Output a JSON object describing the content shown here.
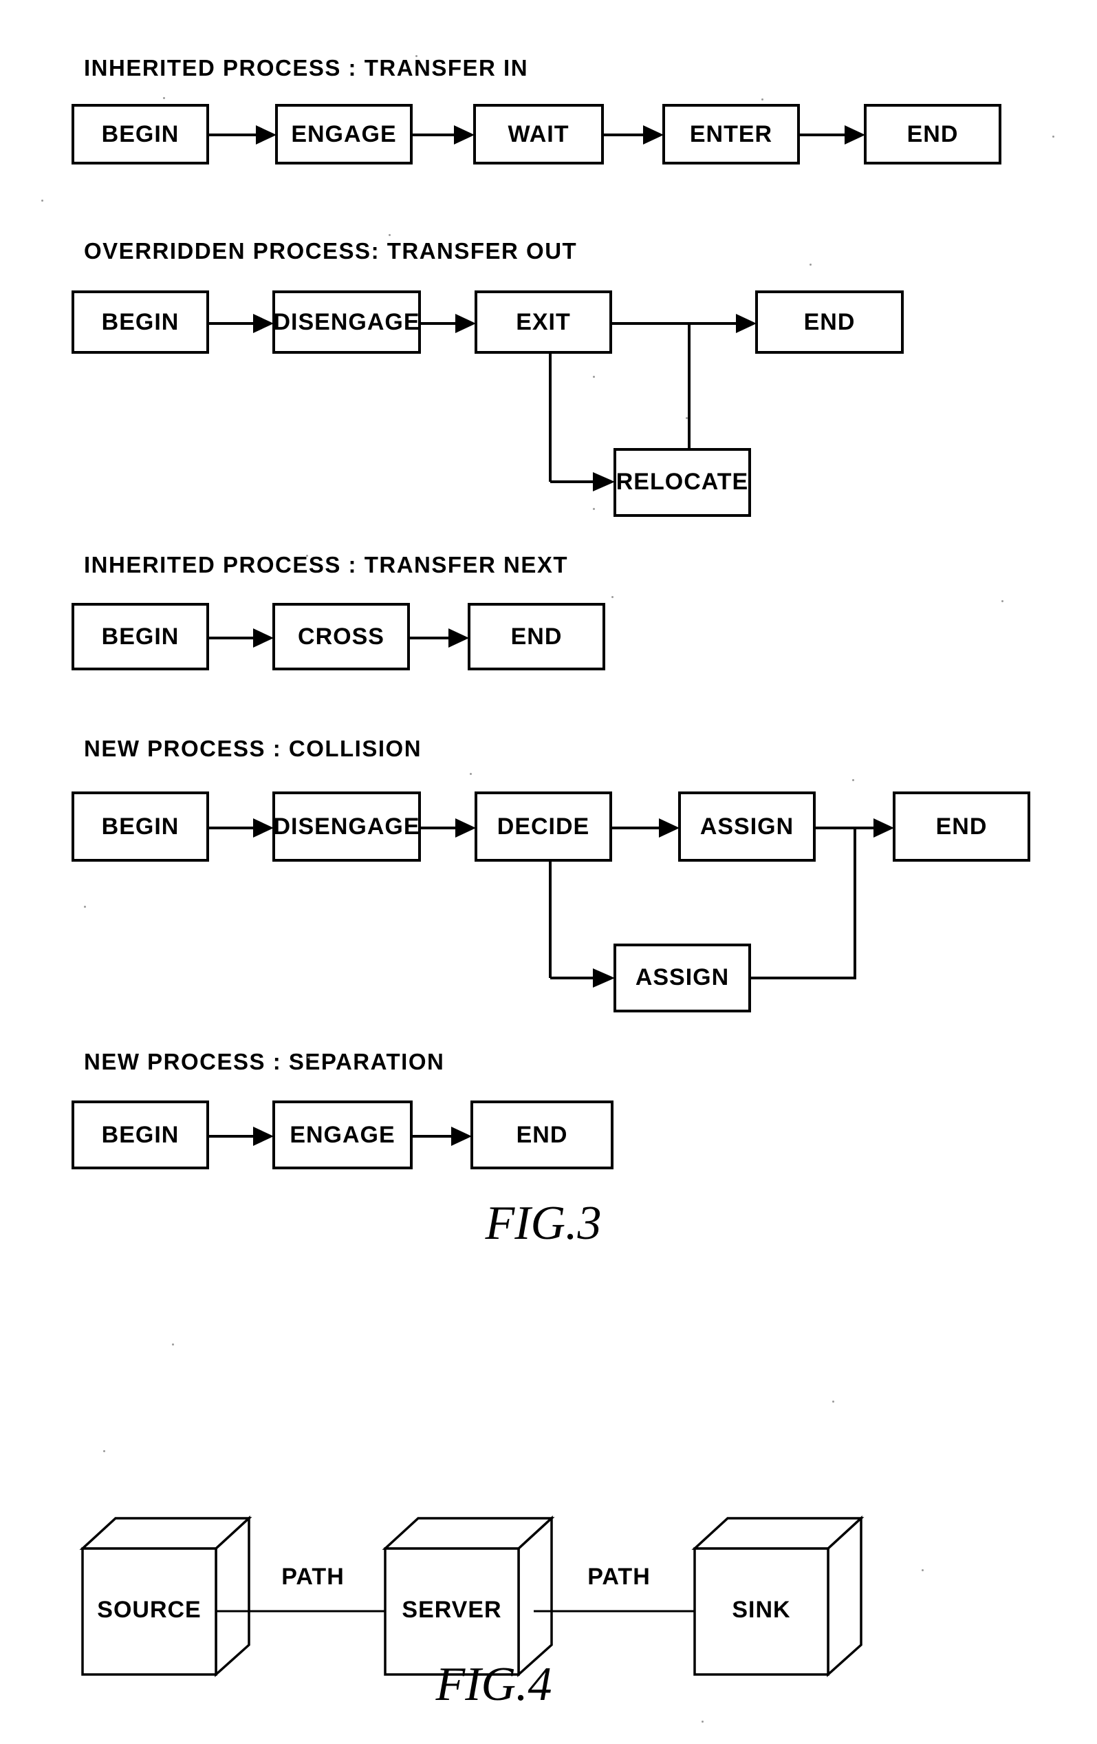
{
  "document": {
    "type": "patent-figure-sheet",
    "figures": [
      "FIG.3",
      "FIG.4"
    ]
  },
  "fig3": {
    "caption": "FIG.3",
    "processes": [
      {
        "heading": "INHERITED PROCESS : TRANSFER IN",
        "nodes": [
          "BEGIN",
          "ENGAGE",
          "WAIT",
          "ENTER",
          "END"
        ],
        "branch_nodes": []
      },
      {
        "heading": "OVERRIDDEN PROCESS: TRANSFER OUT",
        "nodes": [
          "BEGIN",
          "DISENGAGE",
          "EXIT",
          "END"
        ],
        "branch_nodes": [
          "RELOCATE"
        ]
      },
      {
        "heading": "INHERITED PROCESS : TRANSFER NEXT",
        "nodes": [
          "BEGIN",
          "CROSS",
          "END"
        ],
        "branch_nodes": []
      },
      {
        "heading": "NEW PROCESS : COLLISION",
        "nodes": [
          "BEGIN",
          "DISENGAGE",
          "DECIDE",
          "ASSIGN",
          "END"
        ],
        "branch_nodes": [
          "ASSIGN"
        ]
      },
      {
        "heading": "NEW PROCESS : SEPARATION",
        "nodes": [
          "BEGIN",
          "ENGAGE",
          "END"
        ],
        "branch_nodes": []
      }
    ]
  },
  "fig4": {
    "caption": "FIG.4",
    "nodes": [
      "SOURCE",
      "SERVER",
      "SINK"
    ],
    "links": [
      "PATH",
      "PATH"
    ]
  },
  "colors": {
    "ink": "#000000",
    "paper": "#ffffff"
  }
}
